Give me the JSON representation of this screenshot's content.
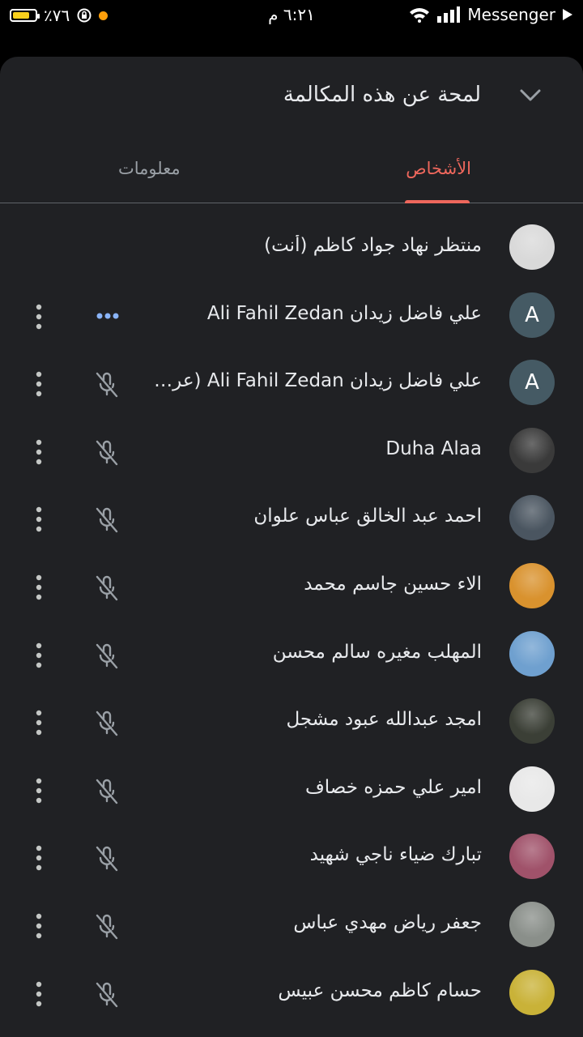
{
  "status_bar": {
    "app": "Messenger",
    "time": "٦:٢١ م",
    "battery_percent": "٪٧٦",
    "battery_level": 0.76
  },
  "header": {
    "title": "لمحة عن هذه المكالمة"
  },
  "tabs": [
    {
      "label": "الأشخاص",
      "active": true
    },
    {
      "label": "معلومات",
      "active": false
    }
  ],
  "participants": [
    {
      "name": "منتظر نهاد جواد كاظم (أنت)",
      "avatar": "photo",
      "avatar_color": "#d9d9d9"
    },
    {
      "name": "علي فاضل زيدان Ali Fahil Zedan",
      "avatar": "letter",
      "letter": "A",
      "speaking": true
    },
    {
      "name": "علي فاضل زيدان Ali Fahil Zedan (عرض تقديمي)",
      "avatar": "letter",
      "letter": "A",
      "muted": true
    },
    {
      "name": "Duha Alaa",
      "avatar": "photo",
      "avatar_color": "#3a3a3a",
      "muted": true
    },
    {
      "name": "احمد عبد الخالق عباس علوان",
      "avatar": "photo",
      "avatar_color": "#4a5560",
      "muted": true
    },
    {
      "name": "الاء حسين جاسم محمد",
      "avatar": "photo",
      "avatar_color": "#d9922e",
      "muted": true
    },
    {
      "name": "المهلب مغيره سالم محسن",
      "avatar": "photo",
      "avatar_color": "#6fa0cf",
      "muted": true
    },
    {
      "name": "امجد عبدالله عبود مشجل",
      "avatar": "photo",
      "avatar_color": "#3b3f36",
      "muted": true
    },
    {
      "name": "امير علي حمزه خصاف",
      "avatar": "photo",
      "avatar_color": "#e8e8e8",
      "muted": true
    },
    {
      "name": "تبارك ضياء ناجي شهيد",
      "avatar": "photo",
      "avatar_color": "#a0526a",
      "muted": true
    },
    {
      "name": "جعفر رياض مهدي عباس",
      "avatar": "photo",
      "avatar_color": "#8a8f8a",
      "muted": true
    },
    {
      "name": "حسام كاظم محسن عبيس",
      "avatar": "photo",
      "avatar_color": "#c9b238",
      "muted": true
    }
  ],
  "colors": {
    "accent": "#ee675c",
    "sheet_background": "#202124",
    "speaking_dots": "#8ab4f8"
  }
}
